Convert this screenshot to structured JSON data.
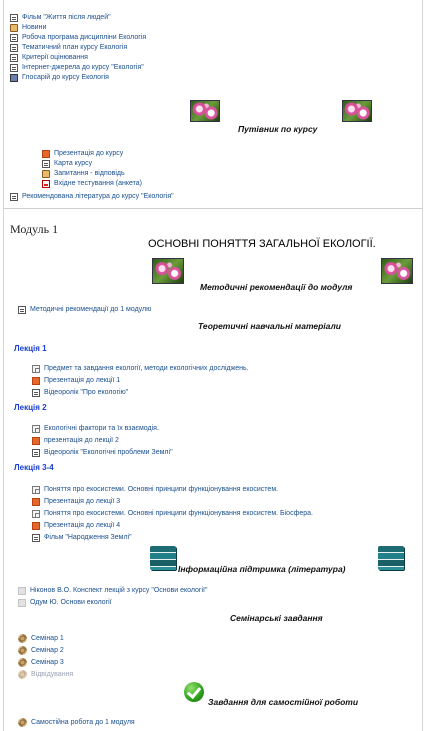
{
  "top_links": [
    {
      "icon": "doc",
      "label": "Фільм \"Життя після людей\""
    },
    {
      "icon": "forum",
      "label": "Новини"
    },
    {
      "icon": "doc",
      "label": "Робоча програма дисципліни Екологія"
    },
    {
      "icon": "doc",
      "label": "Тематичний план курсу Екологія"
    },
    {
      "icon": "doc",
      "label": "Критерії оцінювання"
    },
    {
      "icon": "doc",
      "label": "Інтернет-джерела до курсу \"Екологія\""
    },
    {
      "icon": "book",
      "label": "Глосарій до курсу Екологія"
    }
  ],
  "guide_heading": "Путівник по курсу",
  "guide_links": [
    {
      "icon": "ppt",
      "label": "Презентація до курсу"
    },
    {
      "icon": "doc",
      "label": "Карта курсу"
    },
    {
      "icon": "forum",
      "label": "Запитання - відповідь"
    },
    {
      "icon": "pdf",
      "label": "Вхідне тестування (анкета)"
    }
  ],
  "recommended_link": "Рекомендована література до курсу \"Екологія\"",
  "module_title": "Модуль 1",
  "section_title": "ОСНОВНІ ПОНЯТТЯ ЗАГАЛЬНОЇ ЕКОЛОГІЇ.",
  "method_heading": "Методичні рекомендації до модуля",
  "method_link": "Методичні рекомендації до 1 модулю",
  "theory_heading": "Теоретичні навчальні матеріали",
  "lectures": [
    {
      "title": "Лекція 1",
      "items": [
        {
          "icon": "pages",
          "label": "Предмет та завдання екології, методи екологічних досліджень."
        },
        {
          "icon": "ppt",
          "label": "Презентація до лекції 1"
        },
        {
          "icon": "doc",
          "label": "Відеоролік \"Про екологію\""
        }
      ]
    },
    {
      "title": "Лекція 2",
      "items": [
        {
          "icon": "pages",
          "label": "Екологічні фактори та їх взаємодія."
        },
        {
          "icon": "ppt",
          "label": "презентація до лекції 2"
        },
        {
          "icon": "doc",
          "label": "Відеоролік \"Екологічні проблеми Землі\""
        }
      ]
    },
    {
      "title": "Лекція 3-4",
      "items": [
        {
          "icon": "pages",
          "label": "Поняття про екосистеми. Основні принципи функціонування екосистем."
        },
        {
          "icon": "ppt",
          "label": "Презентація до лекції 3"
        },
        {
          "icon": "pages",
          "label": "Поняття про екосистеми. Основні принципи функціонування екосистем. Біосфера."
        },
        {
          "icon": "ppt",
          "label": "Презентація до лекції 4"
        },
        {
          "icon": "doc",
          "label": "Фільм \"Народження Землі\""
        }
      ]
    }
  ],
  "info_heading": "Інформаційна підтримка (література)",
  "literature_links": [
    {
      "icon": "grey",
      "label": "Ніконов В.О. Конспект лекцій з курсу \"Основи екології\""
    },
    {
      "icon": "grey",
      "label": "Одум Ю. Основи екології"
    }
  ],
  "seminar_heading": "Семінарські завдання",
  "seminars": [
    {
      "icon": "seminar",
      "label": "Семінар 1",
      "dim": false
    },
    {
      "icon": "seminar",
      "label": "Семінар 2",
      "dim": false
    },
    {
      "icon": "seminar",
      "label": "Семінар 3",
      "dim": false
    },
    {
      "icon": "seminar",
      "label": "Відвідування",
      "dim": true
    }
  ],
  "selfwork_heading": "Завдання для самостійної роботи",
  "selfwork_link": "Самостійна робота до 1 модуля"
}
